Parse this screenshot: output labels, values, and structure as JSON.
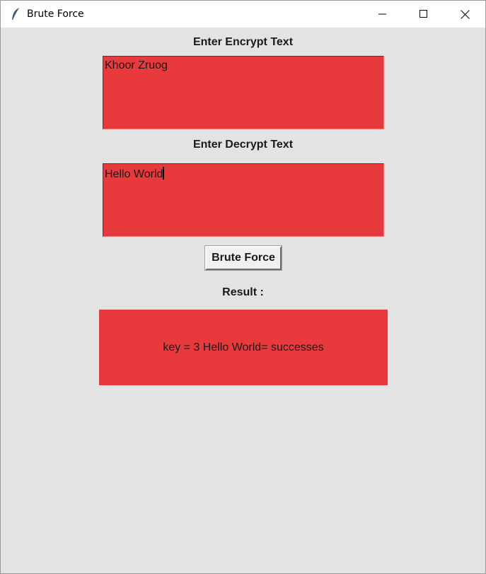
{
  "window": {
    "title": "Brute Force",
    "icon": "feather-icon",
    "controls": [
      "minimize-icon",
      "maximize-icon",
      "close-icon"
    ]
  },
  "form": {
    "encrypt_label": "Enter Encrypt Text",
    "encrypt_value": "Khoor Zruog",
    "decrypt_label": "Enter Decrypt Text",
    "decrypt_value": "Hello World",
    "button_label": "Brute Force",
    "result_label": "Result :",
    "result_value": "key = 3  Hello World= successes"
  },
  "colors": {
    "field_bg": "#e8393c",
    "window_bg": "#e3e3e3"
  }
}
